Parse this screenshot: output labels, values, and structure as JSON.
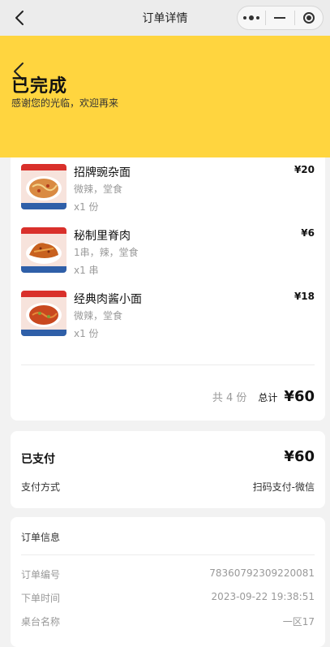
{
  "nav": {
    "title": "订单详情"
  },
  "header": {
    "status": "已完成",
    "subtitle": "感谢您的光临，欢迎再来",
    "background": "#ffd53f"
  },
  "items": [
    {
      "name": "招牌豌杂面",
      "spec": "微辣，堂食",
      "qty": "x1 份",
      "price": "¥20"
    },
    {
      "name": "秘制里脊肉",
      "spec": "1串，辣，堂食",
      "qty": "x1 串",
      "price": "¥6"
    },
    {
      "name": "经典肉酱小面",
      "spec": "微辣，堂食",
      "qty": "x1 份",
      "price": "¥18"
    }
  ],
  "summary": {
    "count": "共 4 份",
    "total_label": "总计",
    "total_value": "¥60"
  },
  "payment": {
    "title": "已支付",
    "amount": "¥60",
    "method_label": "支付方式",
    "method_value": "扫码支付-微信"
  },
  "order_info": {
    "title": "订单信息",
    "rows": [
      {
        "label": "订单编号",
        "value": "78360792309220081"
      },
      {
        "label": "下单时间",
        "value": "2023-09-22 19:38:51"
      },
      {
        "label": "桌台名称",
        "value": "一区17"
      }
    ]
  }
}
